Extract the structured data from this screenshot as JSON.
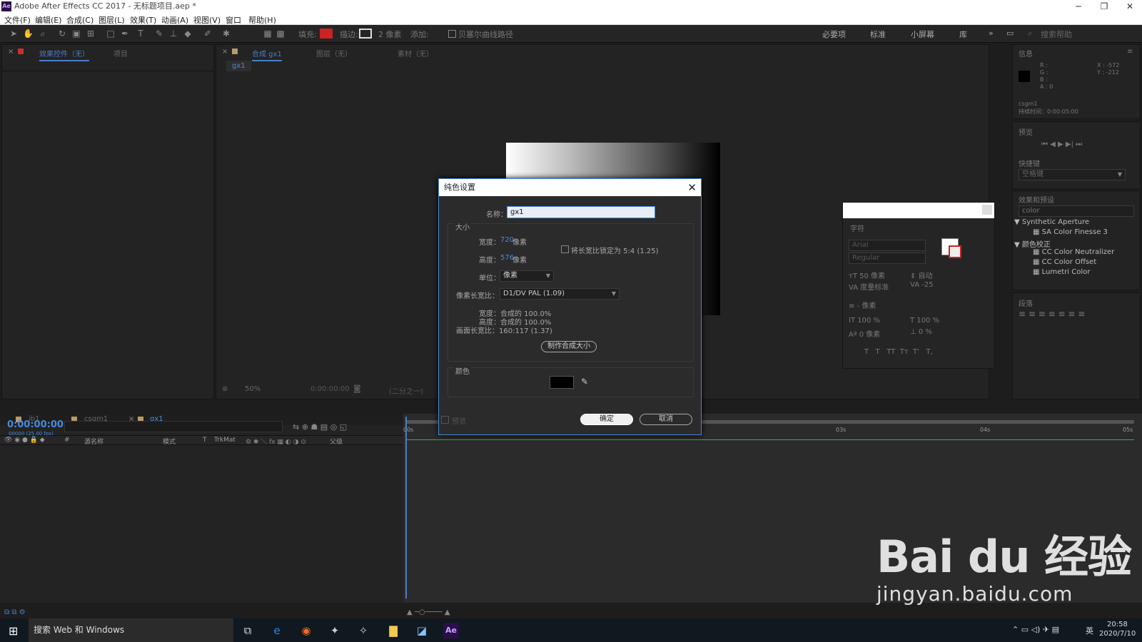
{
  "window": {
    "title": "Adobe After Effects CC 2017 - 无标题项目.aep *",
    "app_icon": "Ae",
    "controls": {
      "minimize": "─",
      "restore": "❐",
      "close": "✕"
    }
  },
  "menu": [
    "文件(F)",
    "编辑(E)",
    "合成(C)",
    "图层(L)",
    "效果(T)",
    "动画(A)",
    "视图(V)",
    "窗口",
    "帮助(H)"
  ],
  "toolbar": {
    "fill_label": "填充:",
    "stroke_label": "描边:",
    "stroke_px": "2 像素",
    "add_label": "添加:",
    "bezier_label": "贝塞尔曲线路径",
    "workspaces": [
      "必要项",
      "标准",
      "小屏幕",
      "库"
    ],
    "more": "»",
    "search_help": "搜索帮助",
    "fill_color": "#cc2222"
  },
  "left_panel": {
    "tabs": [
      "效果控件（无）",
      "项目"
    ]
  },
  "comp_panel": {
    "tabs": [
      "合成 gx1",
      "图层（无）",
      "素材（无）"
    ],
    "sub_tab": "gx1",
    "zoom": "50%",
    "timecode": "0:00:00:00",
    "quality": "(二分之一)"
  },
  "info_panel": {
    "title": "信息",
    "values": [
      "R :",
      "G :",
      "B :",
      "A : 0"
    ],
    "coords": [
      "X : -572",
      "Y : -212"
    ],
    "layer_name": "csgm1",
    "duration": "持续时间：0:00:05:00"
  },
  "preview_panel": {
    "title": "预览",
    "shortcut_label": "快捷键",
    "shortcut_value": "空格键"
  },
  "effects_panel": {
    "title": "效果和预设",
    "search": "color",
    "groups": [
      {
        "name": "Synthetic Aperture",
        "items": [
          "SA Color Finesse 3"
        ]
      },
      {
        "name": "颜色校正",
        "items": [
          "CC Color Neutralizer",
          "CC Color Offset",
          "Lumetri Color"
        ]
      }
    ]
  },
  "paragraph_panel": {
    "title": "段落"
  },
  "character_panel": {
    "title": "字符",
    "font": "Arial",
    "style": "Regular",
    "size": "50 像素",
    "leading": "自动",
    "kerning": "度量标准",
    "tracking": "-25",
    "stroke": "- 像素",
    "vscale": "100 %",
    "hscale": "100 %",
    "baseline": "0 像素",
    "tsume": "0 %",
    "styles": [
      "T",
      "T",
      "TT",
      "Tт",
      "T'",
      "T,"
    ]
  },
  "dialog": {
    "title": "纯色设置",
    "name_label": "名称：",
    "name_value": "gx1",
    "size_group": "大小",
    "width_label": "宽度：",
    "width_value": "720",
    "height_label": "高度：",
    "height_value": "576",
    "px_unit": "像素",
    "lock_label": "将长宽比锁定为 5:4 (1.25)",
    "units_label": "单位：",
    "units_value": "像素",
    "par_label": "像素长宽比：",
    "par_value": "D1/DV PAL (1.09)",
    "pct_width": "宽度：合成的 100.0%",
    "pct_height": "高度：合成的 100.0%",
    "frame_aspect": "画面长宽比：160:117 (1.37)",
    "make_comp_size": "制作合成大小",
    "color_group": "颜色",
    "color_value": "#000000",
    "preview_label": "预览",
    "ok": "确定",
    "cancel": "取消"
  },
  "timeline": {
    "tabs": [
      "jb1",
      "csgm1",
      "gx1"
    ],
    "timecode": "0:00:00:00",
    "fps": "00000 (25.00 fps)",
    "columns": [
      "#",
      "源名称",
      "模式",
      "T",
      "TrkMat",
      "父级"
    ],
    "ruler": [
      "00s",
      "03s",
      "04s",
      "05s"
    ]
  },
  "taskbar": {
    "search": "搜索 Web 和 Windows",
    "time": "20:58",
    "date": "2020/7/10",
    "ime": "英"
  },
  "watermark": {
    "big": "Bai du 经验",
    "small": "jingyan.baidu.com"
  }
}
